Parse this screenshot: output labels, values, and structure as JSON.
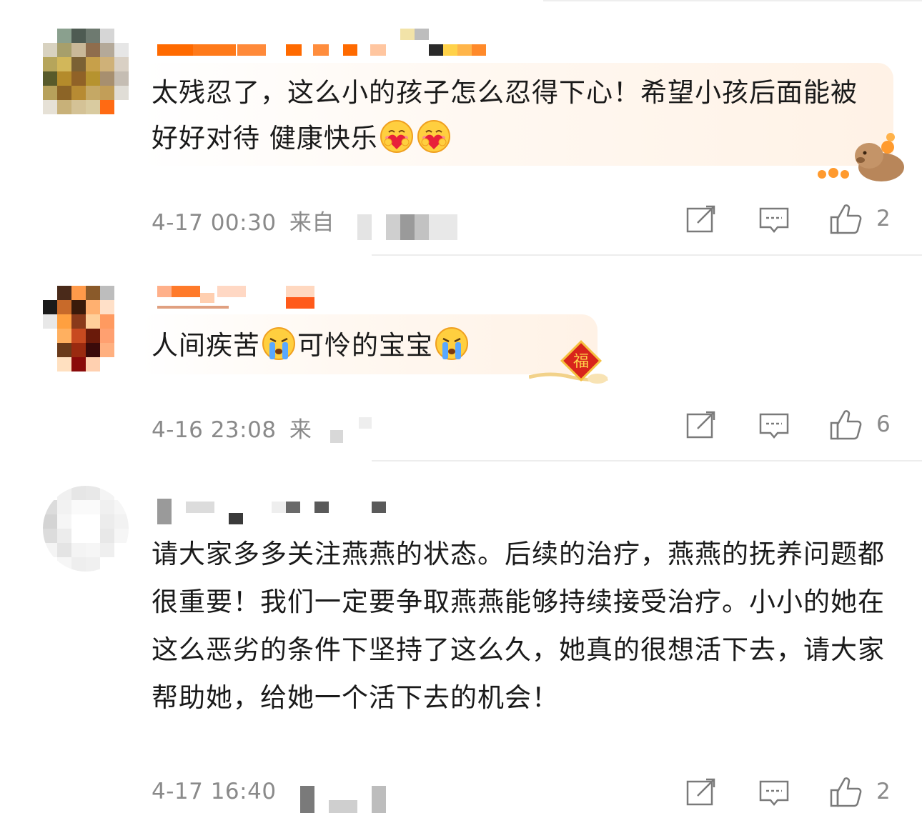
{
  "comments": [
    {
      "text": "太残忍了，这么小的孩子怎么忍得下心！希望小孩后面能被好好对待 健康快乐",
      "emojis": [
        "hug-heart-emoji",
        "hug-heart-emoji"
      ],
      "time": "4-17 00:30",
      "source_prefix": "来自",
      "likes": "2",
      "bubble_decoration": "capybara-with-oranges"
    },
    {
      "text_a": "人间疾苦",
      "text_b": "可怜的宝宝",
      "emojis": [
        "crying-emoji",
        "crying-emoji"
      ],
      "time": "4-16 23:08",
      "source_prefix": "来",
      "likes": "6",
      "bubble_decoration": "fu-lucky-badge"
    },
    {
      "text": "请大家多多关注燕燕的状态。后续的治疗，燕燕的抚养问题都很重要！我们一定要争取燕燕能够持续接受治疗。小小的她在这么恶劣的条件下坚持了这么久，她真的很想活下去，请大家帮助她，给她一个活下去的机会！",
      "time": "4-17 16:40",
      "likes": "2"
    }
  ],
  "action_icons": [
    "repost-icon",
    "comment-icon",
    "like-icon"
  ],
  "colors": {
    "text": "#1a1a1a",
    "meta": "#8a8a8a",
    "icon": "#7a7a7a",
    "separator": "#ededed",
    "username_orange": "#ff6a00"
  }
}
